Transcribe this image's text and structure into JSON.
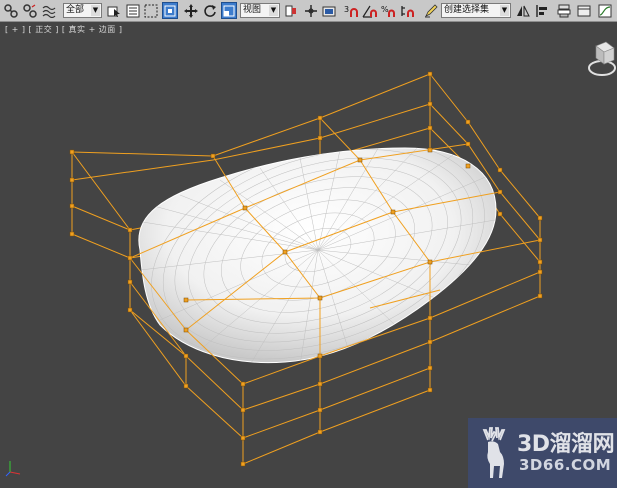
{
  "toolbar": {
    "selection_filter": "全部",
    "reference_coord": "视图",
    "named_selection": "创建选择集"
  },
  "viewport": {
    "label_plus": "[ + ]",
    "label_view": "[ 正交 ]",
    "label_shading": "[ 真实 + 边面 ]"
  },
  "watermark": {
    "brand": "3D溜溜网",
    "url": "3D66.COM"
  },
  "colors": {
    "lattice": "#f0a020",
    "background": "#444444",
    "toolbar": "#c8c8c8",
    "mesh": "#ffffff"
  }
}
